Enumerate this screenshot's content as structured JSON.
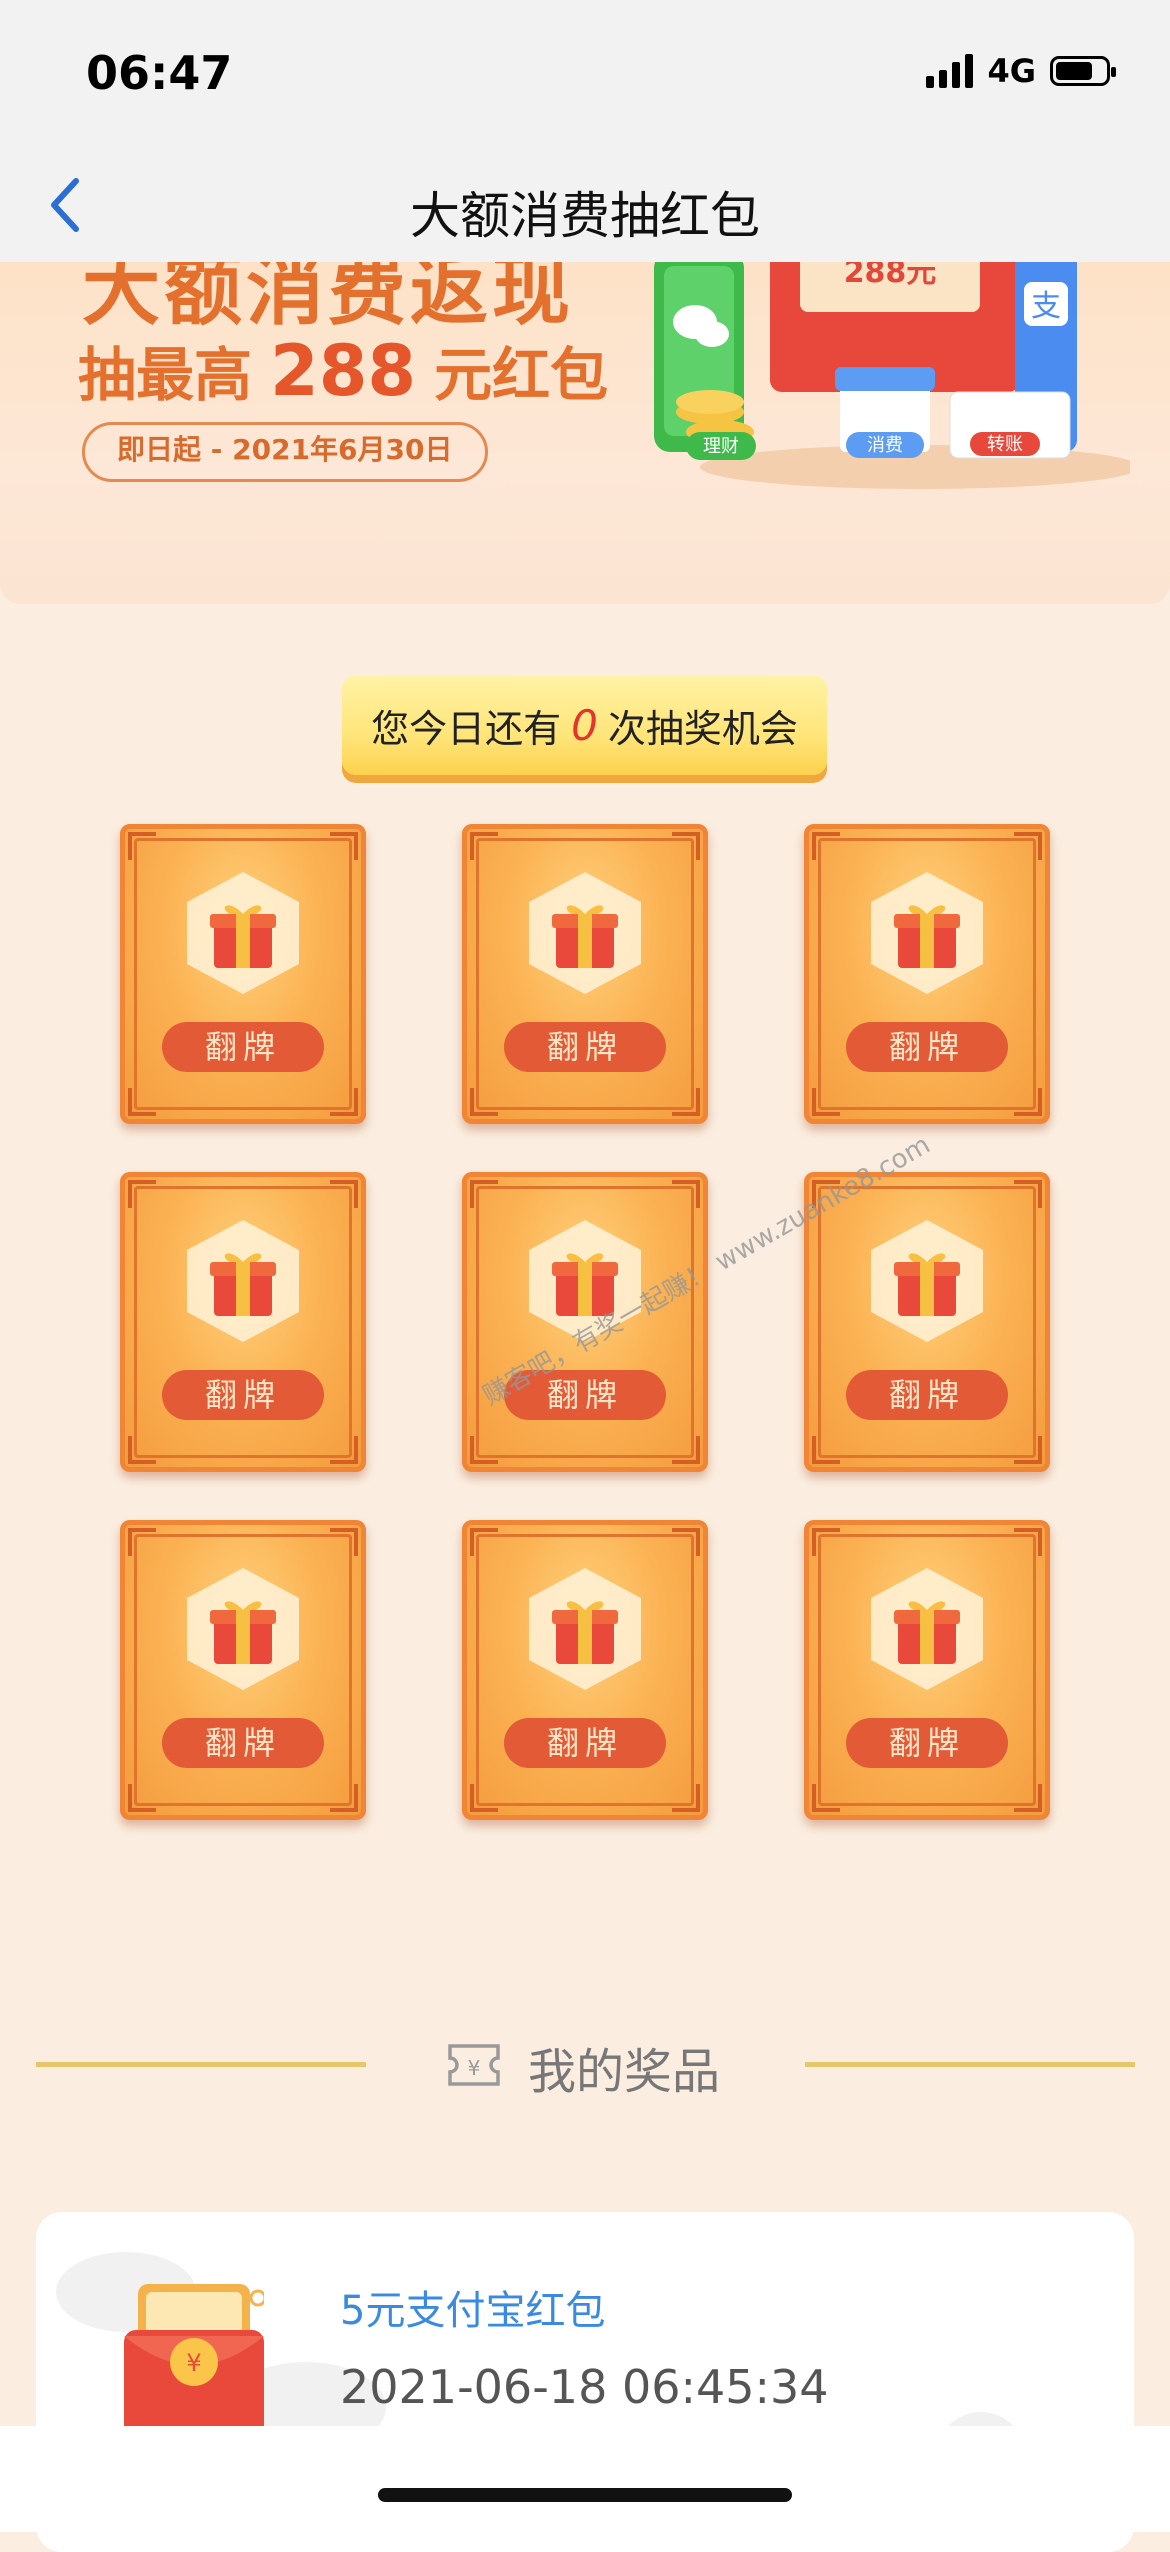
{
  "status_bar": {
    "time": "06:47",
    "network": "4G"
  },
  "nav": {
    "title": "大额消费抽红包"
  },
  "banner": {
    "headline": "大额消费返现",
    "sub_prefix": "抽最高",
    "sub_amount": "288",
    "sub_suffix": "元红包",
    "date_range": "即日起 - 2021年6月30日",
    "tags": [
      "理财",
      "消费",
      "转账"
    ],
    "amount_tag": "288元"
  },
  "chance": {
    "prefix": "您今日还有",
    "count": "0",
    "suffix": "次抽奖机会"
  },
  "cards": [
    {
      "label": "翻牌"
    },
    {
      "label": "翻牌"
    },
    {
      "label": "翻牌"
    },
    {
      "label": "翻牌"
    },
    {
      "label": "翻牌"
    },
    {
      "label": "翻牌"
    },
    {
      "label": "翻牌"
    },
    {
      "label": "翻牌"
    },
    {
      "label": "翻牌"
    }
  ],
  "prizes": {
    "title": "我的奖品",
    "items": [
      {
        "name": "5元支付宝红包",
        "time": "2021-06-18 06:45:34"
      }
    ]
  },
  "watermark": "赚客吧，有奖一起赚！ www.zuanke8.com",
  "colors": {
    "accent": "#e4702e",
    "link": "#3a8be0",
    "card": "#f39a3c"
  }
}
